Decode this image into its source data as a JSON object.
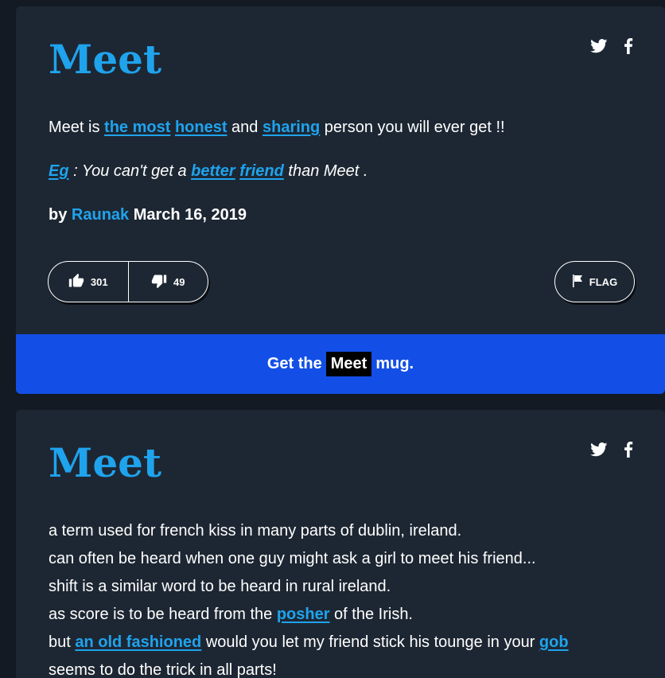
{
  "colors": {
    "page_bg": "#131a23",
    "card_bg": "#1d2733",
    "accent": "#1fa3ed",
    "mug_bar": "#134fe6"
  },
  "entries": [
    {
      "word": "Meet",
      "share": [
        "twitter-icon",
        "facebook-icon"
      ],
      "meaning": {
        "t1": "Meet is ",
        "l1": "the most",
        "t2": " ",
        "l2": "honest",
        "t3": " and ",
        "l3": "sharing",
        "t4": " person you will ever get !!"
      },
      "example": {
        "l1": "Eg",
        "t1": " : You can't get a ",
        "l2": "better",
        "t2": " ",
        "l3": "friend",
        "t3": " than Meet ."
      },
      "byline": {
        "by": "by ",
        "author": "Raunak",
        "date": " March 16, 2019"
      },
      "votes": {
        "up": "301",
        "down": "49"
      },
      "flag_label": "FLAG",
      "mug": {
        "before": "Get the",
        "word": "Meet",
        "after": "mug."
      }
    },
    {
      "word": "Meet",
      "share": [
        "twitter-icon",
        "facebook-icon"
      ],
      "meaning": {
        "line1": "a term used for french kiss in many parts of dublin, ireland.",
        "line2": "can often be heard when one guy might ask a girl to meet his friend...",
        "line3": "shift is a similar word to be heard in rural ireland.",
        "line4a": "as score is to be heard from the ",
        "line4link": "posher",
        "line4b": " of the Irish.",
        "line5a": "but ",
        "line5link1": "an old fashioned",
        "line5b": " would you let my friend stick his tounge in your ",
        "line5link2": "gob",
        "line6": "seems to do the trick in all parts!"
      }
    }
  ]
}
